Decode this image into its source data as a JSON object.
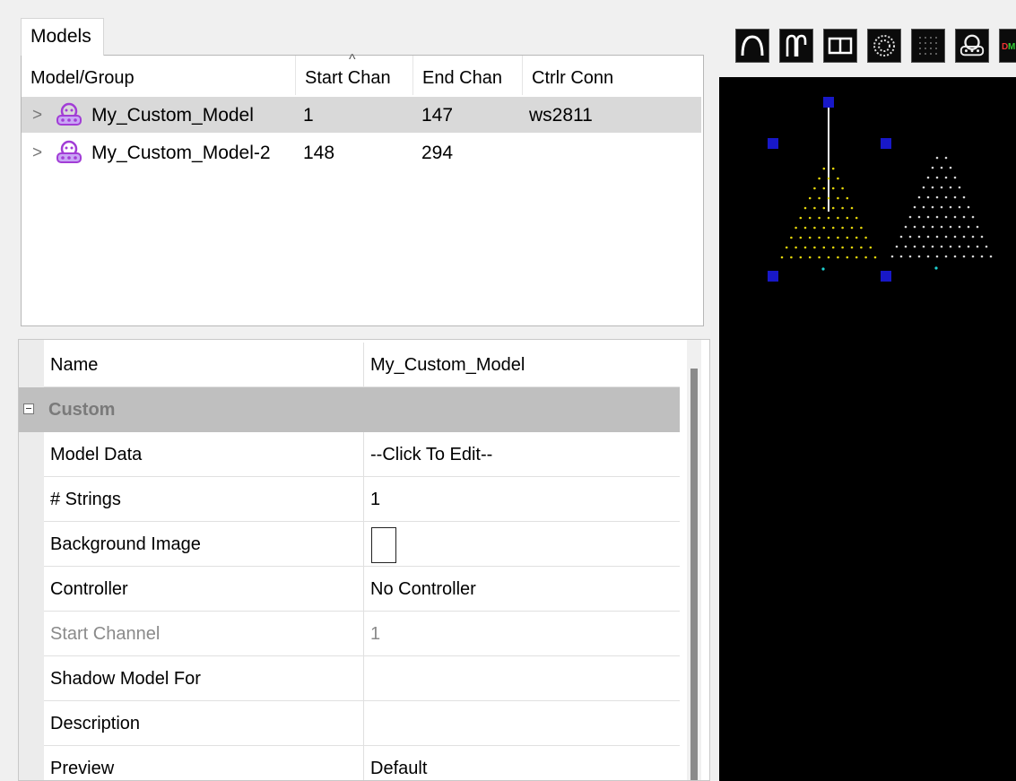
{
  "models_tab": {
    "label": "Models"
  },
  "models_table": {
    "columns": [
      "Model/Group",
      "Start Chan",
      "End Chan",
      "Ctrlr Conn"
    ],
    "rows": [
      {
        "name": "My_Custom_Model",
        "start": "1",
        "end": "147",
        "conn": "ws2811",
        "selected": true
      },
      {
        "name": "My_Custom_Model-2",
        "start": "148",
        "end": "294",
        "conn": "",
        "selected": false
      }
    ]
  },
  "properties": {
    "name_label": "Name",
    "name_value": "My_Custom_Model",
    "category": "Custom",
    "rows": [
      {
        "label": "Model Data",
        "value": "--Click To Edit--"
      },
      {
        "label": "# Strings",
        "value": "1"
      },
      {
        "label": "Background Image",
        "value": ""
      },
      {
        "label": "Controller",
        "value": "No Controller"
      },
      {
        "label": "Start Channel",
        "value": "1"
      },
      {
        "label": "Shadow Model For",
        "value": ""
      },
      {
        "label": "Description",
        "value": ""
      },
      {
        "label": "Preview",
        "value": "Default"
      }
    ]
  },
  "toolbar": {
    "icons": [
      "arch-icon",
      "candy-cane-icon",
      "window-frame-icon",
      "circle-icon",
      "matrix-icon",
      "custom-model-icon",
      "dmx-icon"
    ]
  },
  "colors": {
    "selection": "#d9d9d9",
    "category_bg": "#bfbfbf",
    "handle": "#1818c8",
    "tree1_lights": "#e6d70a",
    "tree2_lights": "#d8d8d8",
    "accent_cyan": "#1fd1d1"
  }
}
